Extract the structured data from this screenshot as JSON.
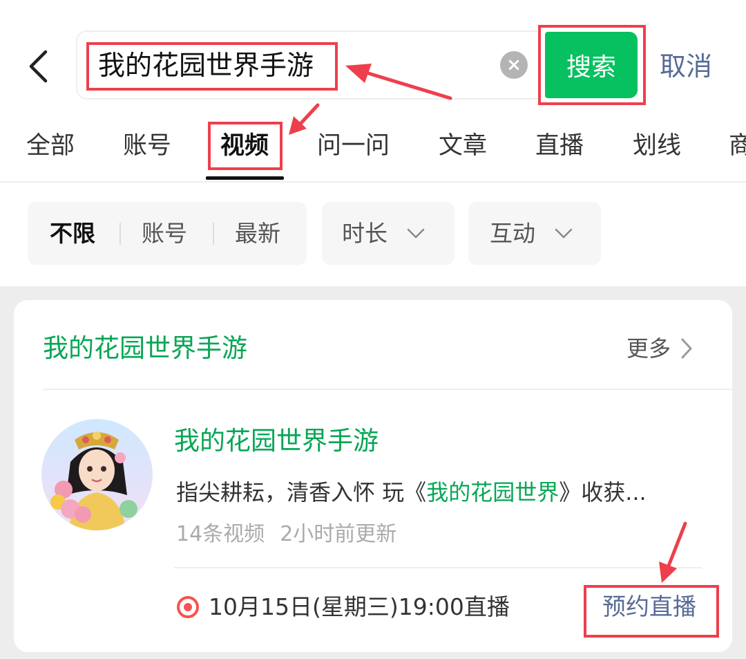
{
  "header": {
    "search_value": "我的花园世界手游",
    "search_button": "搜索",
    "cancel": "取消"
  },
  "tabs": [
    {
      "label": "全部"
    },
    {
      "label": "账号"
    },
    {
      "label": "视频"
    },
    {
      "label": "问一问"
    },
    {
      "label": "文章"
    },
    {
      "label": "直播"
    },
    {
      "label": "划线"
    },
    {
      "label": "商"
    }
  ],
  "active_tab": "视频",
  "filters": {
    "sort_options": [
      "不限",
      "账号",
      "最新"
    ],
    "duration": "时长",
    "interaction": "互动"
  },
  "card": {
    "title": "我的花园世界手游",
    "more": "更多",
    "account": {
      "name": "我的花园世界手游",
      "desc_prefix": "指尖耕耘，清香入怀 玩《",
      "desc_highlight": "我的花园世界",
      "desc_suffix": "》收获...",
      "video_count": "14条视频",
      "updated": "2小时前更新"
    },
    "live": {
      "time": "10月15日(星期三)19:00直播",
      "reserve": "预约直播"
    }
  },
  "colors": {
    "accent_green": "#07c160",
    "link_blue": "#576b95",
    "annotation_red": "#ee3f4d",
    "live_red": "#fa5151"
  }
}
